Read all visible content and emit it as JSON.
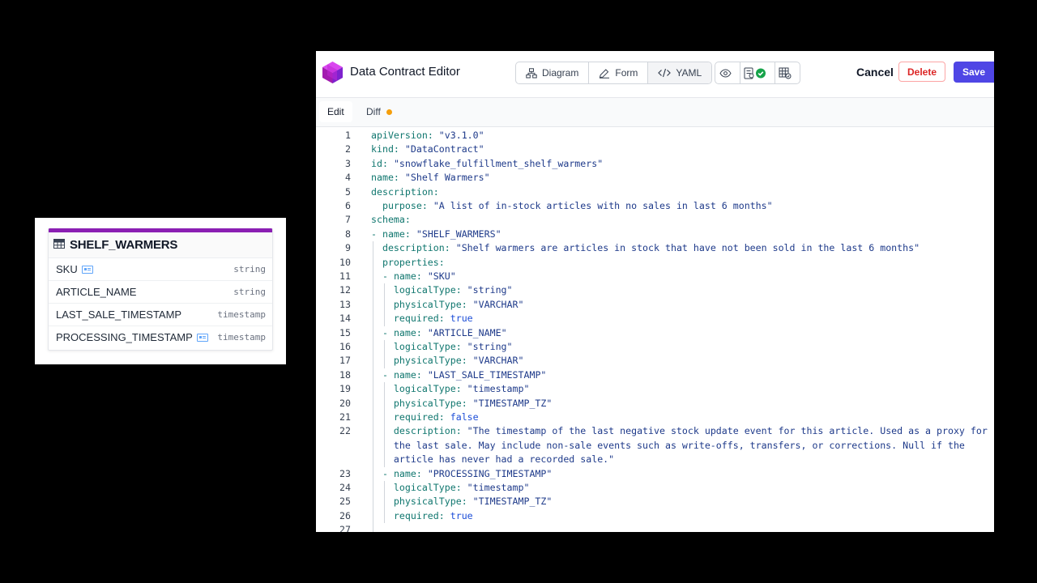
{
  "schema_card": {
    "title": "SHELF_WARMERS",
    "fields": [
      {
        "name": "SKU",
        "type": "string",
        "is_key": true
      },
      {
        "name": "ARTICLE_NAME",
        "type": "string",
        "is_key": false
      },
      {
        "name": "LAST_SALE_TIMESTAMP",
        "type": "timestamp",
        "is_key": false
      },
      {
        "name": "PROCESSING_TIMESTAMP",
        "type": "timestamp",
        "is_key": true
      }
    ]
  },
  "editor": {
    "app_title": "Data Contract Editor",
    "view_tabs": [
      {
        "label": "Diagram",
        "icon": "diagram-icon"
      },
      {
        "label": "Form",
        "icon": "pencil-icon"
      },
      {
        "label": "YAML",
        "icon": "code-icon",
        "active": true
      }
    ],
    "tool_icons": [
      "eye-icon",
      "validate-icon",
      "test-icon"
    ],
    "cancel_label": "Cancel",
    "delete_label": "Delete",
    "save_label": "Save",
    "tabs": [
      {
        "label": "Edit",
        "active": true
      },
      {
        "label": "Diff",
        "has_changes": true
      }
    ],
    "colors": {
      "accent": "#4f46e5",
      "danger": "#dc2626",
      "brand": "#8b1fb3",
      "diff_dot": "#f59e0b"
    }
  },
  "yaml": [
    {
      "n": "1",
      "indent": 0,
      "key": "apiVersion",
      "val": "\"v3.1.0\""
    },
    {
      "n": "2",
      "indent": 0,
      "key": "kind",
      "val": "\"DataContract\""
    },
    {
      "n": "3",
      "indent": 0,
      "key": "id",
      "val": "\"snowflake_fulfillment_shelf_warmers\""
    },
    {
      "n": "4",
      "indent": 0,
      "key": "name",
      "val": "\"Shelf Warmers\""
    },
    {
      "n": "5",
      "indent": 0,
      "key": "description",
      "val": ""
    },
    {
      "n": "6",
      "indent": 2,
      "key": "purpose",
      "val": "\"A list of in-stock articles with no sales in last 6 months\""
    },
    {
      "n": "7",
      "indent": 0,
      "key": "schema",
      "val": ""
    },
    {
      "n": "8",
      "indent": 0,
      "dash": true,
      "key": "name",
      "val": "\"SHELF_WARMERS\""
    },
    {
      "n": "9",
      "indent": 2,
      "key": "description",
      "val": "\"Shelf warmers are articles in stock that have not been sold in the last 6 months\""
    },
    {
      "n": "10",
      "indent": 2,
      "key": "properties",
      "val": ""
    },
    {
      "n": "11",
      "indent": 2,
      "dash": true,
      "key": "name",
      "val": "\"SKU\""
    },
    {
      "n": "12",
      "indent": 4,
      "key": "logicalType",
      "val": "\"string\""
    },
    {
      "n": "13",
      "indent": 4,
      "key": "physicalType",
      "val": "\"VARCHAR\""
    },
    {
      "n": "14",
      "indent": 4,
      "key": "required",
      "val": "true",
      "bool": true
    },
    {
      "n": "15",
      "indent": 2,
      "dash": true,
      "key": "name",
      "val": "\"ARTICLE_NAME\""
    },
    {
      "n": "16",
      "indent": 4,
      "key": "logicalType",
      "val": "\"string\""
    },
    {
      "n": "17",
      "indent": 4,
      "key": "physicalType",
      "val": "\"VARCHAR\""
    },
    {
      "n": "18",
      "indent": 2,
      "dash": true,
      "key": "name",
      "val": "\"LAST_SALE_TIMESTAMP\""
    },
    {
      "n": "19",
      "indent": 4,
      "key": "logicalType",
      "val": "\"timestamp\""
    },
    {
      "n": "20",
      "indent": 4,
      "key": "physicalType",
      "val": "\"TIMESTAMP_TZ\""
    },
    {
      "n": "21",
      "indent": 4,
      "key": "required",
      "val": "false",
      "bool": true
    },
    {
      "n": "22",
      "indent": 4,
      "key": "description",
      "val": "\"The timestamp of the last negative stock update event for this article. Used as a proxy for",
      "cont": [
        "the last sale. May include non-sale events such as write-offs, transfers, or corrections. Null if the",
        "article has never had a recorded sale.\""
      ]
    },
    {
      "n": "23",
      "indent": 2,
      "dash": true,
      "key": "name",
      "val": "\"PROCESSING_TIMESTAMP\""
    },
    {
      "n": "24",
      "indent": 4,
      "key": "logicalType",
      "val": "\"timestamp\""
    },
    {
      "n": "25",
      "indent": 4,
      "key": "physicalType",
      "val": "\"TIMESTAMP_TZ\""
    },
    {
      "n": "26",
      "indent": 4,
      "key": "required",
      "val": "true",
      "bool": true
    },
    {
      "n": "27",
      "indent": 0,
      "key": "",
      "val": ""
    }
  ]
}
